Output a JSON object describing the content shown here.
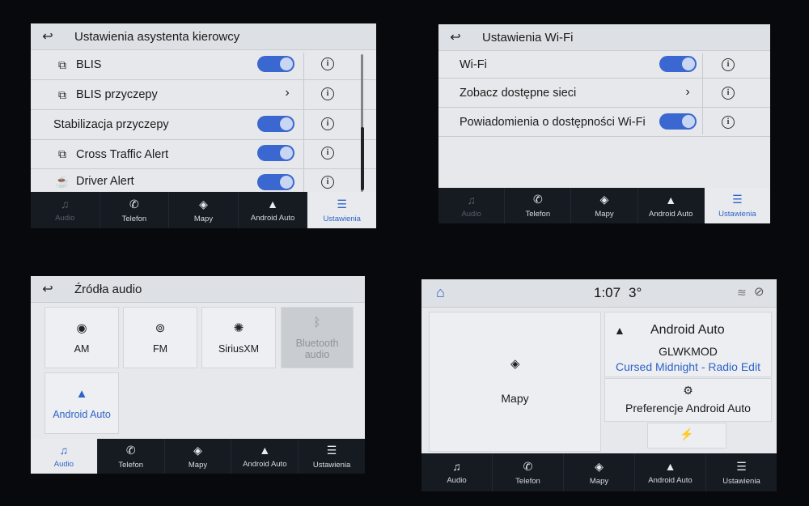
{
  "driver_assist": {
    "title": "Ustawienia asystenta kierowcy",
    "rows": [
      {
        "label": "BLIS",
        "icon": "blis-icon",
        "control": "toggle",
        "on": true
      },
      {
        "label": "BLIS przyczepy",
        "icon": "trailer-blis-icon",
        "control": "chevron"
      },
      {
        "label": "Stabilizacja przyczepy",
        "icon": "",
        "control": "toggle",
        "on": true
      },
      {
        "label": "Cross Traffic Alert",
        "icon": "cross-traffic-icon",
        "control": "toggle",
        "on": true
      },
      {
        "label": "Driver Alert",
        "icon": "coffee-icon",
        "control": "toggle",
        "on": true
      }
    ]
  },
  "wifi": {
    "title": "Ustawienia Wi-Fi",
    "rows": [
      {
        "label": "Wi-Fi",
        "control": "toggle",
        "on": true
      },
      {
        "label": "Zobacz dostępne sieci",
        "control": "chevron"
      },
      {
        "label": "Powiadomienia o dostępności Wi-Fi",
        "control": "toggle",
        "on": true
      }
    ]
  },
  "audio_sources": {
    "title": "Źródła audio",
    "tiles": [
      {
        "label": "AM",
        "icon": "radio-tower-icon",
        "state": "normal"
      },
      {
        "label": "FM",
        "icon": "radio-antenna-icon",
        "state": "normal"
      },
      {
        "label": "SiriusXM",
        "icon": "siriusxm-icon",
        "state": "normal"
      },
      {
        "label": "Bluetooth audio",
        "icon": "bluetooth-icon",
        "state": "disabled"
      },
      {
        "label": "Android Auto",
        "icon": "android-auto-icon",
        "state": "selected"
      }
    ]
  },
  "home": {
    "time": "1:07",
    "temperature": "3°",
    "maps_label": "Mapy",
    "android_auto_title": "Android Auto",
    "artist": "GLWKMOD",
    "track": "Cursed Midnight - Radio Edit",
    "preferences_label": "Preferencje Android Auto"
  },
  "nav_labels": {
    "audio": "Audio",
    "phone": "Telefon",
    "maps": "Mapy",
    "android_auto": "Android Auto",
    "settings": "Ustawienia"
  },
  "icons": {
    "back": "↩",
    "info": "i",
    "chevron": "›",
    "home": "⌂"
  },
  "colors": {
    "accent": "#2f63c9",
    "toggle_on": "#3a68d0",
    "navbar": "#161a21",
    "screen_bg": "#e6e8eb"
  }
}
